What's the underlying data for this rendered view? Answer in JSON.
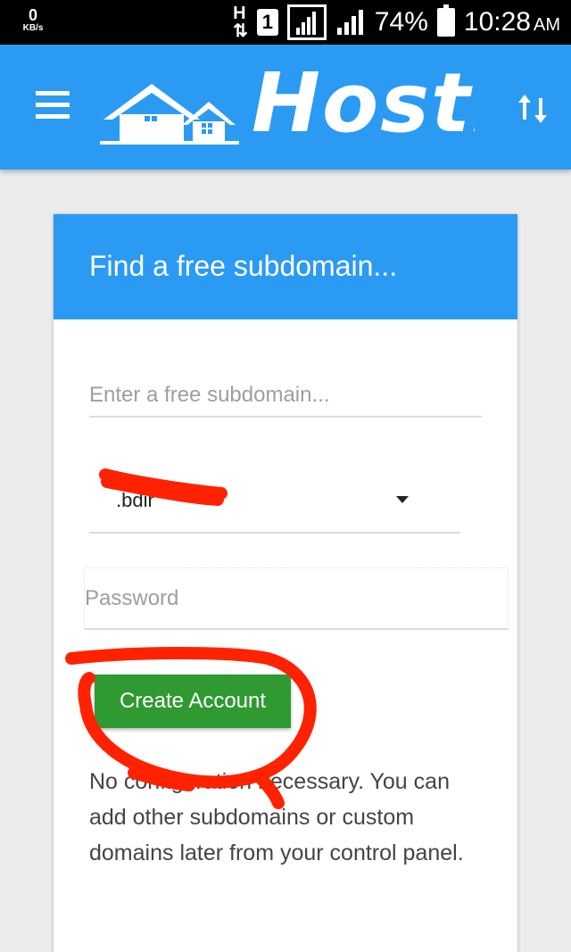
{
  "status_bar": {
    "net_speed_value": "0",
    "net_speed_unit": "KB/s",
    "sim_label": "1",
    "battery": "74%",
    "time": "10:28",
    "ampm": "AM"
  },
  "app_bar": {
    "brand": "HostB"
  },
  "card": {
    "title": "Find a free subdomain...",
    "subdomain_placeholder": "Enter a free subdomain...",
    "domain_select_value": ".bdir",
    "password_placeholder": "Password",
    "create_button": "Create Account",
    "description": "No configuration necessary. You can add other subdomains or custom domains later from your control panel."
  },
  "colors": {
    "primary_blue": "#2b9af3",
    "button_green": "#2f9a31",
    "annotation_red": "#ff2200"
  }
}
